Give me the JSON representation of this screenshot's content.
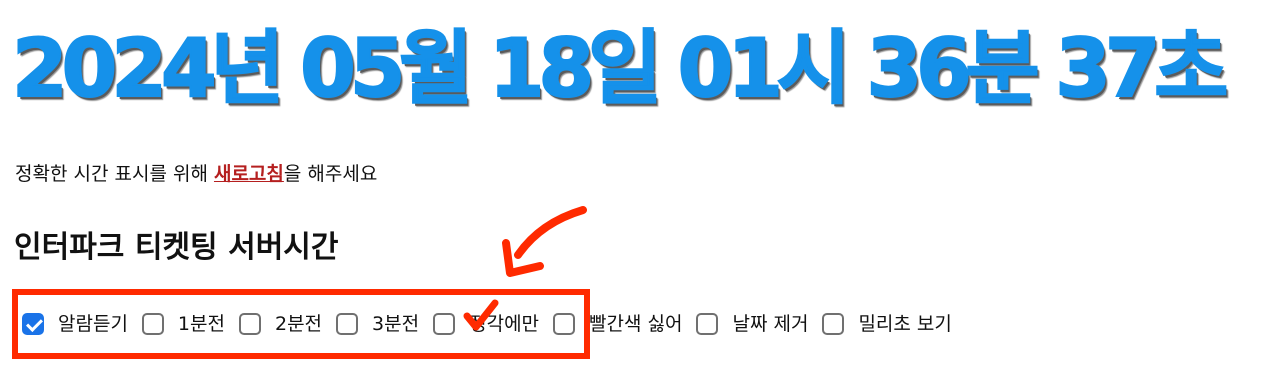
{
  "clock": {
    "text": "2024년 05월 18일 01시 36분 37초"
  },
  "notice": {
    "before": "정확한 시간 표시를 위해 ",
    "link": "새로고침",
    "after": "을 해주세요"
  },
  "section": {
    "title": "인터파크 티켓팅 서버시간"
  },
  "options": [
    {
      "label": "알람듣기",
      "checked": true
    },
    {
      "label": "1분전",
      "checked": false
    },
    {
      "label": "2분전",
      "checked": false
    },
    {
      "label": "3분전",
      "checked": false
    },
    {
      "label": "정각에만",
      "checked": false
    },
    {
      "label": "빨간색 싫어",
      "checked": false
    },
    {
      "label": "날짜 제거",
      "checked": false
    },
    {
      "label": "밀리초 보기",
      "checked": false
    }
  ],
  "colors": {
    "clock": "#1591ea",
    "link": "#b51f1f",
    "annotation": "#ff2a00",
    "checked": "#1a73e8"
  },
  "icons": {
    "annotation_arrow": "curved-arrow-icon",
    "annotation_check": "red-checkmark-icon"
  }
}
